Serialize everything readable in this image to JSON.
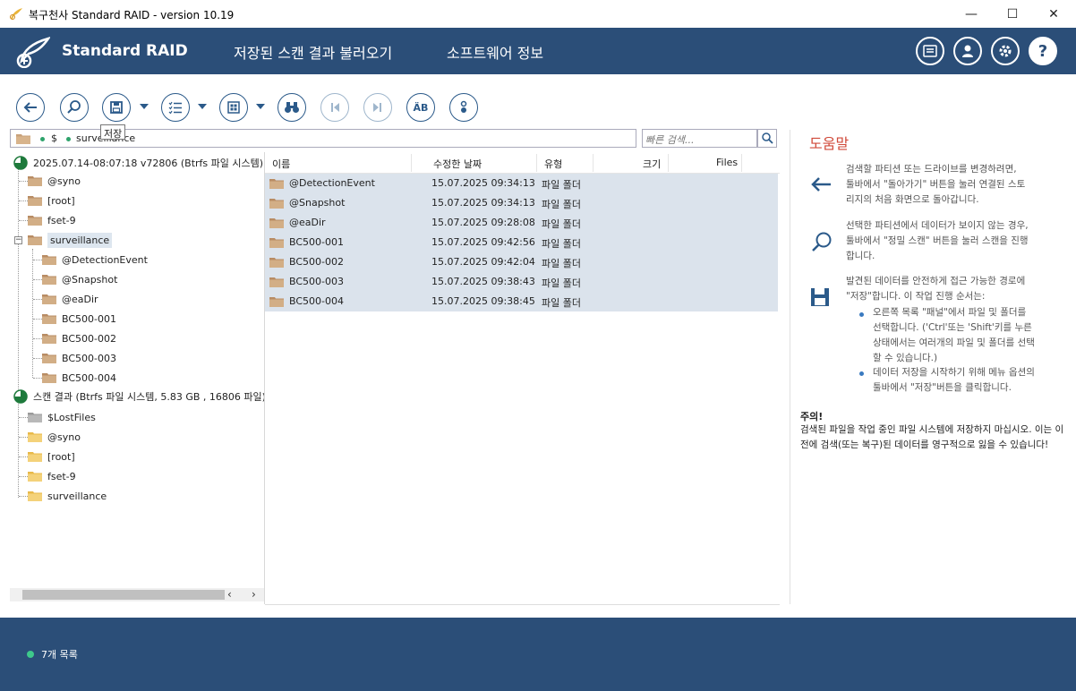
{
  "window": {
    "title": "복구천사 Standard RAID - version 10.19",
    "min": "—",
    "max": "☐",
    "close": "✕"
  },
  "header": {
    "brand": "Standard RAID",
    "menu": [
      "저장된 스캔 결과 불러오기",
      "소프트웨어 정보"
    ]
  },
  "toolbar": {
    "tooltip": "저장"
  },
  "pathbar": {
    "segments": [
      "$",
      "surveillance"
    ]
  },
  "search": {
    "placeholder": "빠른 검색..."
  },
  "tree": {
    "root1": "2025.07.14-08:07:18 v72806 (Btrfs 파일 시스템)",
    "root1_children": [
      "@syno",
      "[root]",
      "fset-9",
      "surveillance"
    ],
    "surveillance_children": [
      "@DetectionEvent",
      "@Snapshot",
      "@eaDir",
      "BC500-001",
      "BC500-002",
      "BC500-003",
      "BC500-004"
    ],
    "root2": "스캔 결과 (Btrfs 파일 시스템, 5.83 GB , 16806 파일)",
    "root2_children": [
      "$LostFiles",
      "@syno",
      "[root]",
      "fset-9",
      "surveillance"
    ]
  },
  "list": {
    "columns": [
      "이름",
      "수정한 날짜",
      "유형",
      "크기",
      "Files"
    ],
    "rows": [
      {
        "name": "@DetectionEvent",
        "date": "15.07.2025 09:34:13",
        "type": "파일 폴더"
      },
      {
        "name": "@Snapshot",
        "date": "15.07.2025 09:34:13",
        "type": "파일 폴더"
      },
      {
        "name": "@eaDir",
        "date": "15.07.2025 09:28:08",
        "type": "파일 폴더"
      },
      {
        "name": "BC500-001",
        "date": "15.07.2025 09:42:56",
        "type": "파일 폴더"
      },
      {
        "name": "BC500-002",
        "date": "15.07.2025 09:42:04",
        "type": "파일 폴더"
      },
      {
        "name": "BC500-003",
        "date": "15.07.2025 09:38:43",
        "type": "파일 폴더"
      },
      {
        "name": "BC500-004",
        "date": "15.07.2025 09:38:45",
        "type": "파일 폴더"
      }
    ]
  },
  "help": {
    "title": "도움말",
    "p1": [
      "검색할 파티션 또는 드라이브를 변경하려면,",
      "툴바에서 \"돌아가기\" 버튼을 눌러 연결된 스토",
      "리지의 처음 화면으로 돌아갑니다."
    ],
    "p2": [
      "선택한 파티션에서 데이터가 보이지 않는 경우,",
      "툴바에서 \"정밀 스캔\" 버튼을 눌러 스캔을 진행",
      "합니다."
    ],
    "p3": [
      "발견된 데이터를 안전하게 접근 가능한 경로에",
      "\"저장\"합니다. 이 작업 진행 순서는:"
    ],
    "b1": [
      "오른쪽 목록 \"패널\"에서 파일 및 폴더를",
      "선택합니다. ('Ctrl'또는 'Shift'키를 누른",
      "상태에서는 여러개의 파일 및 폴더를 선택",
      "할 수 있습니다.)"
    ],
    "b2": [
      "데이터 저장을 시작하기 위해 메뉴 옵션의",
      "툴바에서 \"저장\"버튼을 클릭합니다."
    ],
    "note_title": "주의!",
    "note": "검색된 파일을 작업 중인 파일 시스템에 저장하지 마십시오. 이는 이전에 검색(또는 복구)된 데이터를 영구적으로 잃을 수 있습니다!"
  },
  "status": {
    "text": "7개 목록"
  },
  "colors": {
    "header_bg": "#2b4e78",
    "accent": "#2b5a8a",
    "selection": "#dbe3ec",
    "help_title": "#d04a3a",
    "status_dot": "#3ec98b"
  }
}
